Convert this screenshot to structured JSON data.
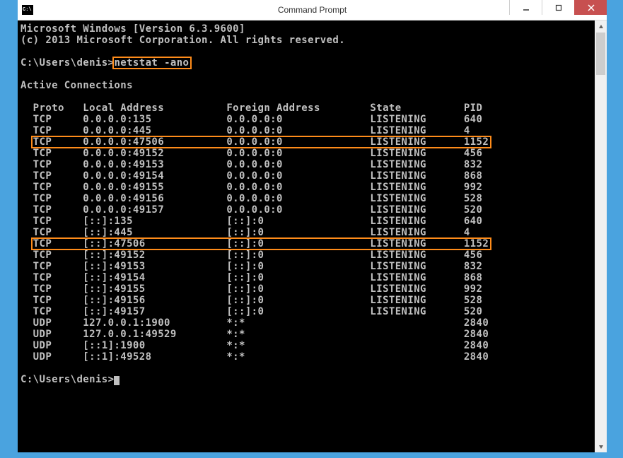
{
  "window": {
    "title": "Command Prompt"
  },
  "header": {
    "line1": "Microsoft Windows [Version 6.3.9600]",
    "line2": "(c) 2013 Microsoft Corporation. All rights reserved."
  },
  "prompt": {
    "path": "C:\\Users\\denis>",
    "command": "netstat -ano",
    "path2": "C:\\Users\\denis>"
  },
  "section_title": "Active Connections",
  "columns": {
    "proto": "Proto",
    "local": "Local Address",
    "foreign": "Foreign Address",
    "state": "State",
    "pid": "PID"
  },
  "rows": [
    {
      "proto": "TCP",
      "local": "0.0.0.0:135",
      "foreign": "0.0.0.0:0",
      "state": "LISTENING",
      "pid": "640",
      "hl": false
    },
    {
      "proto": "TCP",
      "local": "0.0.0.0:445",
      "foreign": "0.0.0.0:0",
      "state": "LISTENING",
      "pid": "4",
      "hl": false
    },
    {
      "proto": "TCP",
      "local": "0.0.0.0:47506",
      "foreign": "0.0.0.0:0",
      "state": "LISTENING",
      "pid": "1152",
      "hl": true
    },
    {
      "proto": "TCP",
      "local": "0.0.0.0:49152",
      "foreign": "0.0.0.0:0",
      "state": "LISTENING",
      "pid": "456",
      "hl": false
    },
    {
      "proto": "TCP",
      "local": "0.0.0.0:49153",
      "foreign": "0.0.0.0:0",
      "state": "LISTENING",
      "pid": "832",
      "hl": false
    },
    {
      "proto": "TCP",
      "local": "0.0.0.0:49154",
      "foreign": "0.0.0.0:0",
      "state": "LISTENING",
      "pid": "868",
      "hl": false
    },
    {
      "proto": "TCP",
      "local": "0.0.0.0:49155",
      "foreign": "0.0.0.0:0",
      "state": "LISTENING",
      "pid": "992",
      "hl": false
    },
    {
      "proto": "TCP",
      "local": "0.0.0.0:49156",
      "foreign": "0.0.0.0:0",
      "state": "LISTENING",
      "pid": "528",
      "hl": false
    },
    {
      "proto": "TCP",
      "local": "0.0.0.0:49157",
      "foreign": "0.0.0.0:0",
      "state": "LISTENING",
      "pid": "520",
      "hl": false
    },
    {
      "proto": "TCP",
      "local": "[::]:135",
      "foreign": "[::]:0",
      "state": "LISTENING",
      "pid": "640",
      "hl": false
    },
    {
      "proto": "TCP",
      "local": "[::]:445",
      "foreign": "[::]:0",
      "state": "LISTENING",
      "pid": "4",
      "hl": false
    },
    {
      "proto": "TCP",
      "local": "[::]:47506",
      "foreign": "[::]:0",
      "state": "LISTENING",
      "pid": "1152",
      "hl": true
    },
    {
      "proto": "TCP",
      "local": "[::]:49152",
      "foreign": "[::]:0",
      "state": "LISTENING",
      "pid": "456",
      "hl": false
    },
    {
      "proto": "TCP",
      "local": "[::]:49153",
      "foreign": "[::]:0",
      "state": "LISTENING",
      "pid": "832",
      "hl": false
    },
    {
      "proto": "TCP",
      "local": "[::]:49154",
      "foreign": "[::]:0",
      "state": "LISTENING",
      "pid": "868",
      "hl": false
    },
    {
      "proto": "TCP",
      "local": "[::]:49155",
      "foreign": "[::]:0",
      "state": "LISTENING",
      "pid": "992",
      "hl": false
    },
    {
      "proto": "TCP",
      "local": "[::]:49156",
      "foreign": "[::]:0",
      "state": "LISTENING",
      "pid": "528",
      "hl": false
    },
    {
      "proto": "TCP",
      "local": "[::]:49157",
      "foreign": "[::]:0",
      "state": "LISTENING",
      "pid": "520",
      "hl": false
    },
    {
      "proto": "UDP",
      "local": "127.0.0.1:1900",
      "foreign": "*:*",
      "state": "",
      "pid": "2840",
      "hl": false
    },
    {
      "proto": "UDP",
      "local": "127.0.0.1:49529",
      "foreign": "*:*",
      "state": "",
      "pid": "2840",
      "hl": false
    },
    {
      "proto": "UDP",
      "local": "[::1]:1900",
      "foreign": "*:*",
      "state": "",
      "pid": "2840",
      "hl": false
    },
    {
      "proto": "UDP",
      "local": "[::1]:49528",
      "foreign": "*:*",
      "state": "",
      "pid": "2840",
      "hl": false
    }
  ]
}
